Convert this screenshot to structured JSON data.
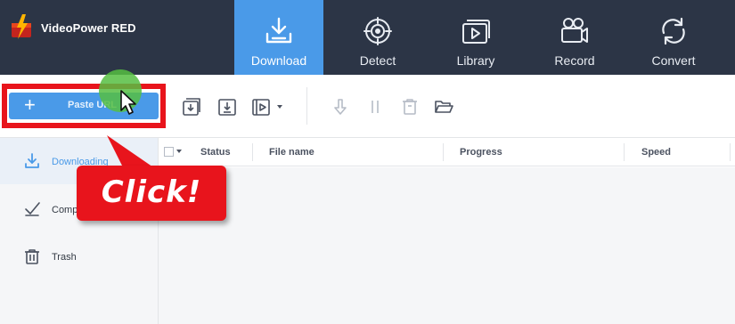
{
  "app": {
    "title": "VideoPower RED"
  },
  "nav": {
    "tabs": [
      {
        "label": "Download",
        "icon": "download-icon",
        "active": true
      },
      {
        "label": "Detect",
        "icon": "target-icon",
        "active": false
      },
      {
        "label": "Library",
        "icon": "library-icon",
        "active": false
      },
      {
        "label": "Record",
        "icon": "camera-icon",
        "active": false
      },
      {
        "label": "Convert",
        "icon": "convert-icon",
        "active": false
      }
    ]
  },
  "toolbar": {
    "paste_plus": "+",
    "paste_label": "Paste URL"
  },
  "callout": {
    "text": "Click!"
  },
  "sidebar": {
    "items": [
      {
        "label": "Downloading",
        "icon": "download-arrow-icon",
        "active": true
      },
      {
        "label": "Comp",
        "icon": "checkmark-icon",
        "active": false
      },
      {
        "label": "Trash",
        "icon": "trash-icon",
        "active": false
      }
    ]
  },
  "table": {
    "columns": [
      "Status",
      "File name",
      "Progress",
      "Speed"
    ],
    "rows": []
  },
  "colors": {
    "topbar": "#2c3546",
    "accent": "#4a9ae8",
    "highlight": "#e8141c",
    "cursor_halo": "#56be42"
  }
}
